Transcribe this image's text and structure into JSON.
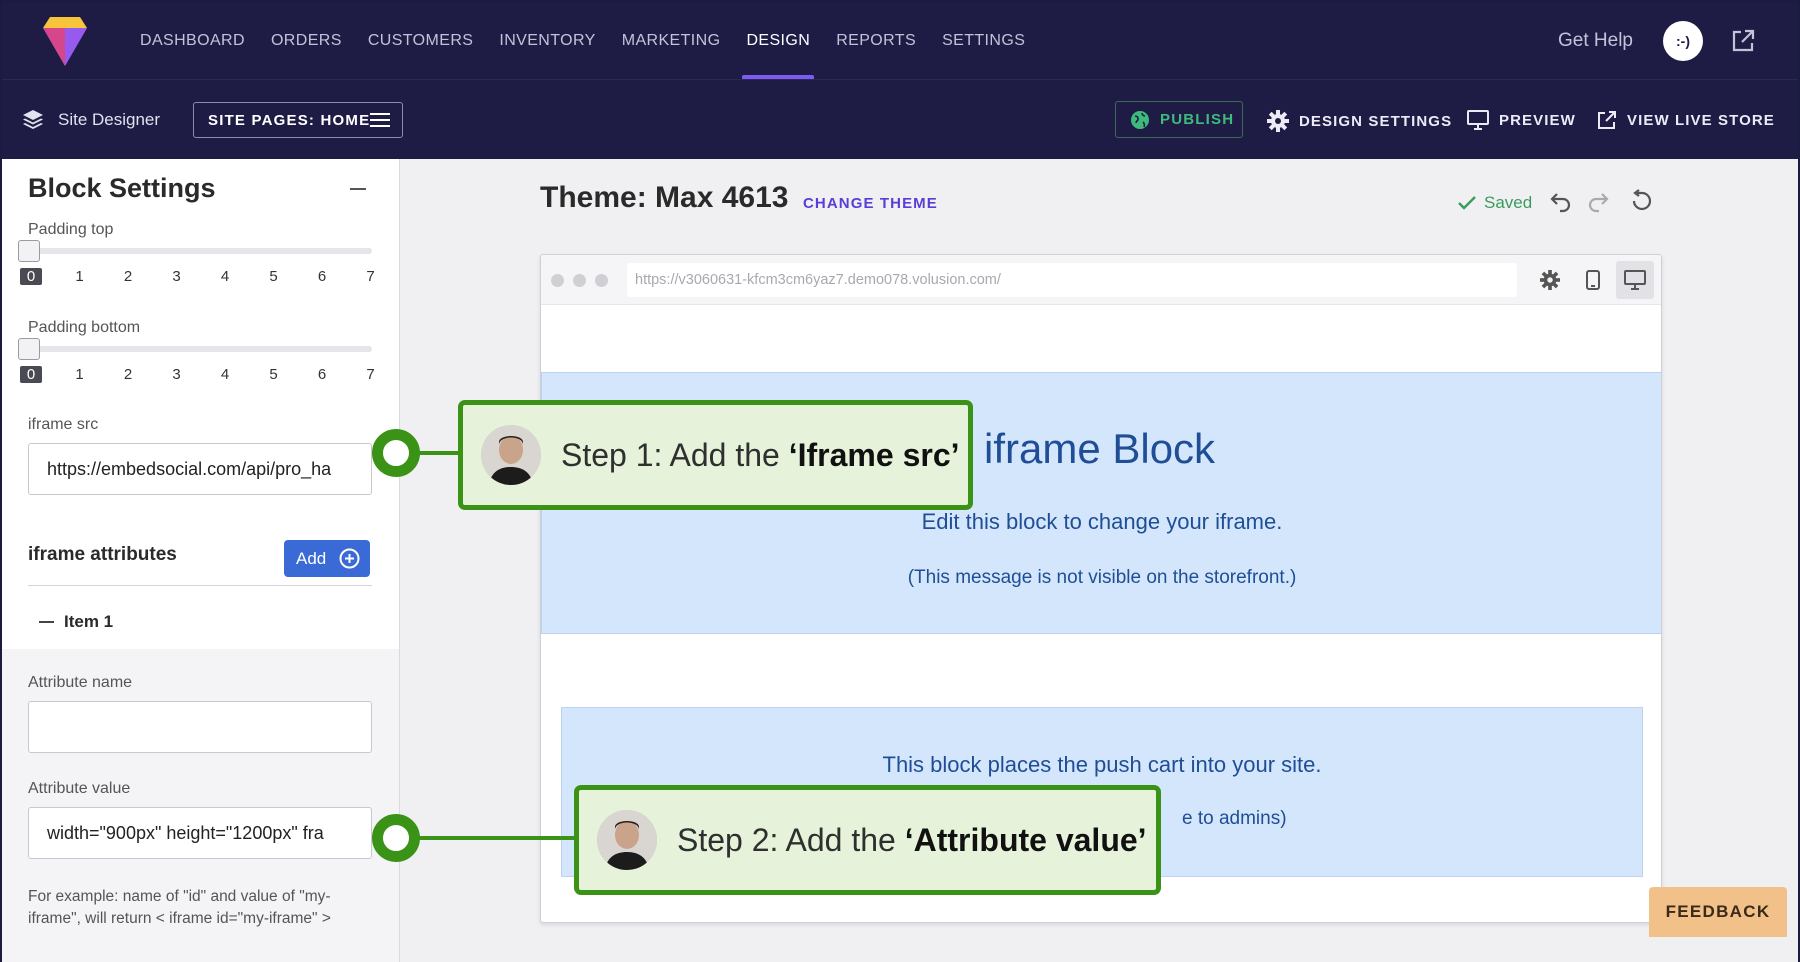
{
  "nav": {
    "items": [
      "DASHBOARD",
      "ORDERS",
      "CUSTOMERS",
      "INVENTORY",
      "MARKETING",
      "DESIGN",
      "REPORTS",
      "SETTINGS"
    ],
    "active": "DESIGN",
    "get_help": "Get Help",
    "avatar_text": ":-)"
  },
  "toolbar": {
    "site_designer": "Site Designer",
    "site_pages": "SITE PAGES: HOME",
    "publish": "PUBLISH",
    "design_settings": "DESIGN SETTINGS",
    "preview": "PREVIEW",
    "view_live_store": "VIEW LIVE STORE"
  },
  "panel": {
    "title": "Block Settings",
    "padding_top_label": "Padding top",
    "padding_top_value": 0,
    "padding_bottom_label": "Padding bottom",
    "padding_bottom_value": 0,
    "scale": [
      "0",
      "1",
      "2",
      "3",
      "4",
      "5",
      "6",
      "7"
    ],
    "iframe_src_label": "iframe src",
    "iframe_src_value": "https://embedsocial.com/api/pro_ha",
    "attrs_title": "iframe attributes",
    "add_label": "Add",
    "item_label": "Item 1",
    "attr_name_label": "Attribute name",
    "attr_name_value": "",
    "attr_value_label": "Attribute value",
    "attr_value_value": "width=\"900px\" height=\"1200px\" fra",
    "help_text": "For example: name of \"id\" and value of \"my-iframe\", will return < iframe id=\"my-iframe\" >"
  },
  "canvas": {
    "theme_title": "Theme: Max 4613",
    "change_theme": "CHANGE THEME",
    "saved": "Saved",
    "url": "https://v3060631-kfcm3cm6yaz7.demo078.volusion.com/",
    "iframe_block_title": "iframe Block",
    "iframe_block_sub": "Edit this block to change your iframe.",
    "iframe_block_note": "(This message is not visible on the storefront.)",
    "cart_block_title": "This block places the push cart into your site.",
    "cart_block_note": "e to admins)",
    "feedback": "FEEDBACK"
  },
  "steps": [
    {
      "prefix": "Step 1: Add the ",
      "bold": "‘Iframe src’"
    },
    {
      "prefix": "Step 2: Add the ",
      "bold": "‘Attribute value’"
    }
  ],
  "colors": {
    "nav_bg": "#1e1c45",
    "accent": "#7c5cf0",
    "publish": "#3fba7d",
    "callout_border": "#3a9317",
    "callout_bg": "#e6f3da",
    "block_bg": "#d4e6fc",
    "block_text": "#1f4e96",
    "feedback_bg": "#f2c089"
  },
  "icons": [
    "logo-icon",
    "external-link-icon",
    "layers-icon",
    "hamburger-icon",
    "globe-icon",
    "gear-icon",
    "monitor-icon",
    "external-link-icon",
    "plus-circle-icon",
    "check-icon",
    "undo-icon",
    "redo-icon",
    "reset-icon",
    "mobile-icon",
    "desktop-icon"
  ]
}
